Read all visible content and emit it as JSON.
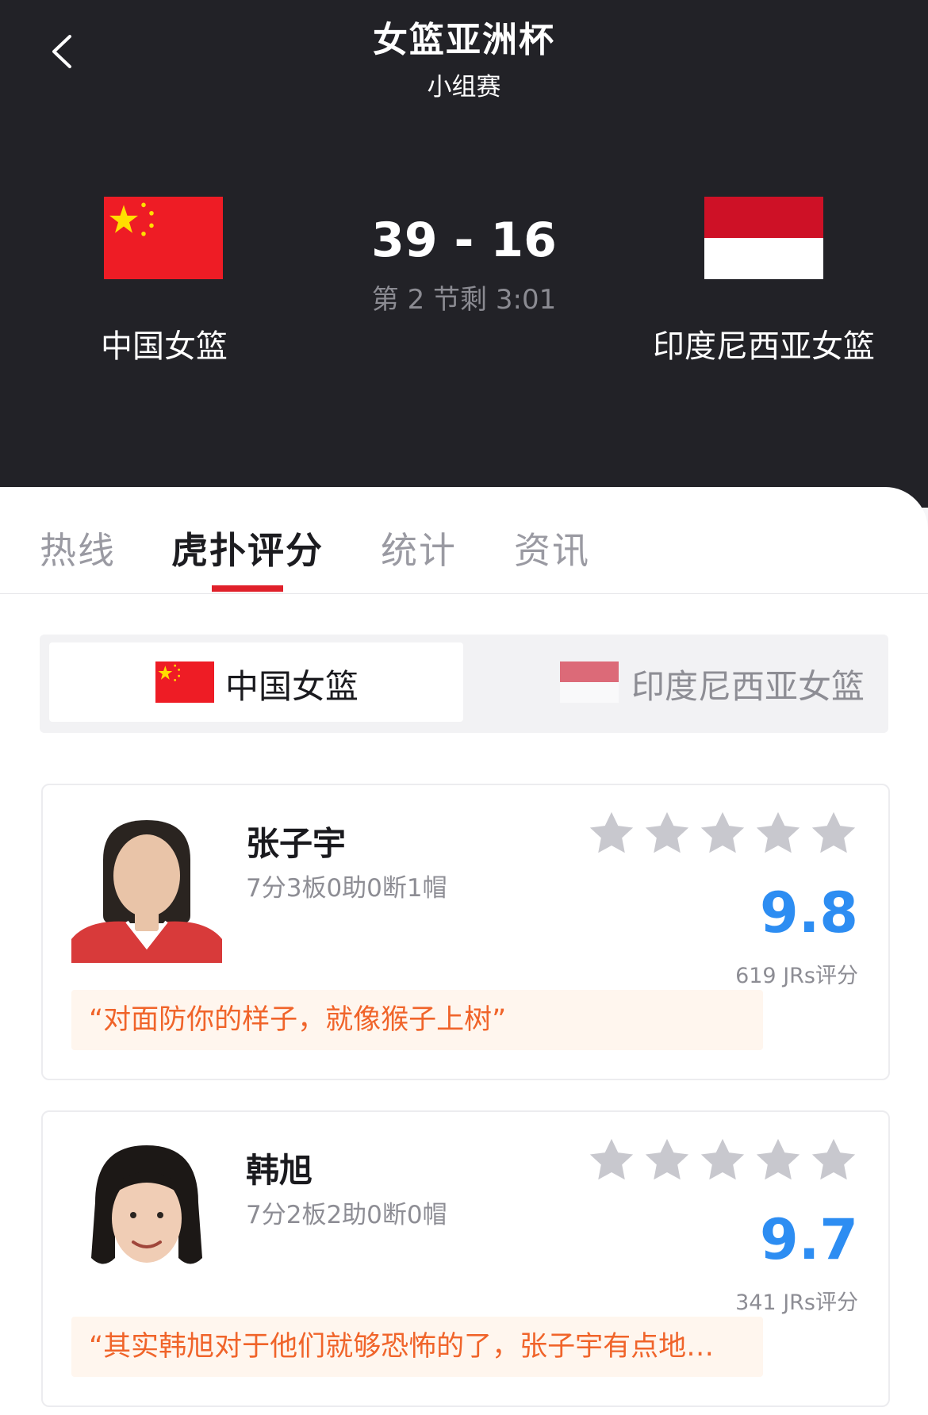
{
  "header": {
    "title": "女篮亚洲杯",
    "subtitle": "小组赛",
    "home_team": "中国女篮",
    "away_team": "印度尼西亚女篮",
    "score": "39 - 16",
    "period": "第 2 节剩 3:01"
  },
  "tabs": [
    {
      "label": "热线",
      "active": false
    },
    {
      "label": "虎扑评分",
      "active": true
    },
    {
      "label": "统计",
      "active": false
    },
    {
      "label": "资讯",
      "active": false
    }
  ],
  "team_switch": {
    "home_label": "中国女篮",
    "away_label": "印度尼西亚女篮",
    "selected": "home"
  },
  "players": [
    {
      "name": "张子宇",
      "stats": "7分3板0助0断1帽",
      "rating": "9.8",
      "votes": "619 JRs评分",
      "quote": "“对面防你的样子，就像猴子上树”",
      "stars": 5
    },
    {
      "name": "韩旭",
      "stats": "7分2板2助0断0帽",
      "rating": "9.7",
      "votes": "341 JRs评分",
      "quote": "“其实韩旭对于他们就够恐怖的了，张子宇有点地…",
      "stars": 5
    }
  ],
  "colors": {
    "header_bg": "#222227",
    "accent_red": "#e0202a",
    "rating_blue": "#2d8df2",
    "quote_orange": "#f0642a",
    "star_gray": "#c8c8ce",
    "flag_red_cn": "#ee1c25",
    "flag_yellow_cn": "#ffde00",
    "flag_red_id": "#ce1126"
  },
  "icons": {
    "back": "chevron-left-icon",
    "star": "star-icon"
  }
}
